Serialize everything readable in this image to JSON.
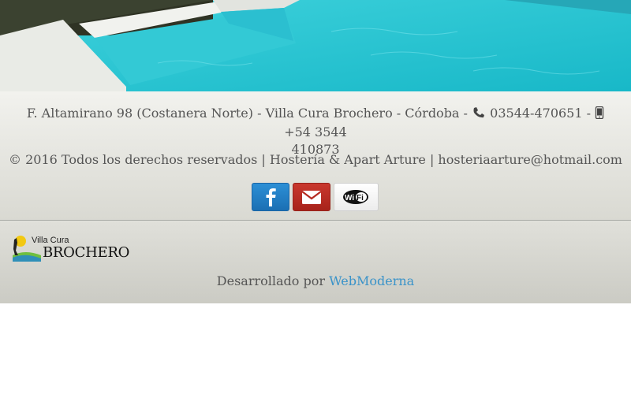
{
  "footer": {
    "address": "F. Altamirano 98 (Costanera Norte) - Villa Cura Brochero - Córdoba -",
    "phone_landline": "03544-470651 -",
    "phone_mobile_line1": "+54 3544",
    "phone_mobile_line2": "410873",
    "copyright": "© 2016 Todos los derechos reservados | Hostería & Apart Arture | hosteriaarture@hotmail.com"
  },
  "social": {
    "icons": [
      "facebook-icon",
      "mail-icon",
      "wifi-icon"
    ]
  },
  "logo": {
    "small_text": "Villa Cura",
    "big_text": "BROCHERO"
  },
  "credits": {
    "prefix": "Desarrollado por",
    "link_label": "WebModerna"
  },
  "colors": {
    "facebook": "#1b6fb3",
    "mail": "#b52a21",
    "link": "#3a93c9",
    "text": "#555555"
  }
}
